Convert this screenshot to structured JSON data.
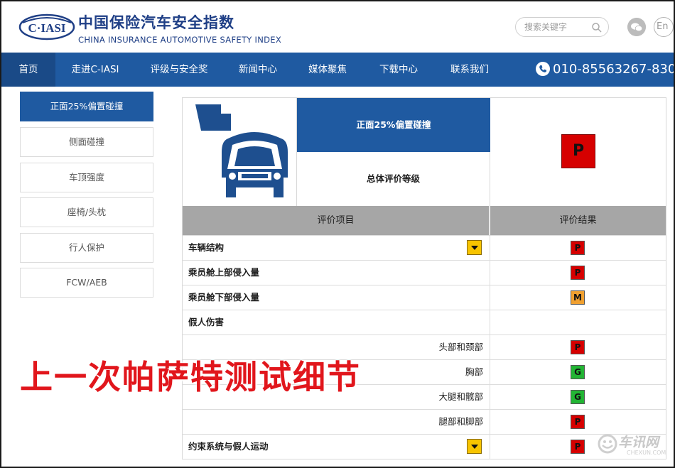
{
  "header": {
    "logo_text": "C·IASI",
    "title_cn": "中国保险汽车安全指数",
    "title_en": "CHINA INSURANCE AUTOMOTIVE SAFETY INDEX",
    "search_placeholder": "搜索关键字",
    "lang_button": "En"
  },
  "nav": {
    "items": [
      {
        "label": "首页",
        "active": true
      },
      {
        "label": "走进C-IASI"
      },
      {
        "label": "评级与安全奖"
      },
      {
        "label": "新闻中心"
      },
      {
        "label": "媒体聚焦"
      },
      {
        "label": "下载中心"
      },
      {
        "label": "联系我们"
      }
    ],
    "phone": "010-85563267-830"
  },
  "sidebar": {
    "items": [
      {
        "label": "正面25%偏置碰撞",
        "active": true
      },
      {
        "label": "侧面碰撞"
      },
      {
        "label": "车顶强度"
      },
      {
        "label": "座椅/头枕"
      },
      {
        "label": "行人保护"
      },
      {
        "label": "FCW/AEB"
      }
    ]
  },
  "summary": {
    "test_title": "正面25%偏置碰撞",
    "overall_label": "总体评价等级",
    "overall_rating": "P"
  },
  "table": {
    "col_item": "评价项目",
    "col_result": "评价结果",
    "rows": [
      {
        "label": "车辆结构",
        "level": "main",
        "warn": true,
        "rating": "P"
      },
      {
        "label": "乘员舱上部侵入量",
        "level": "main",
        "warn": false,
        "rating": "P"
      },
      {
        "label": "乘员舱下部侵入量",
        "level": "main",
        "warn": false,
        "rating": "M"
      },
      {
        "label": "假人伤害",
        "level": "main",
        "warn": false,
        "rating": ""
      },
      {
        "label": "头部和颈部",
        "level": "sub",
        "warn": false,
        "rating": "P"
      },
      {
        "label": "胸部",
        "level": "sub",
        "warn": false,
        "rating": "G"
      },
      {
        "label": "大腿和髋部",
        "level": "sub",
        "warn": false,
        "rating": "G"
      },
      {
        "label": "腿部和脚部",
        "level": "sub",
        "warn": false,
        "rating": "P"
      },
      {
        "label": "约束系统与假人运动",
        "level": "main",
        "warn": true,
        "rating": "P"
      }
    ]
  },
  "rating_colors": {
    "P": "#d60000",
    "M": "#f0a030",
    "G": "#22b534"
  },
  "brand_color": "#1f5aa1",
  "overlay_caption": "上一次帕萨特测试细节",
  "watermark": {
    "text": "车讯网",
    "sub": "CHEXUN.COM"
  }
}
